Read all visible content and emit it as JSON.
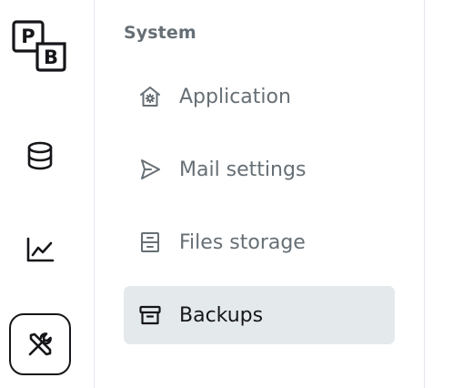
{
  "logo": {
    "letter_top": "P",
    "letter_bottom": "B"
  },
  "rail": {
    "items": [
      {
        "icon": "database-icon",
        "active": false
      },
      {
        "icon": "chart-line-icon",
        "active": false
      },
      {
        "icon": "tools-icon",
        "active": true
      }
    ]
  },
  "sidebar": {
    "section_title": "System",
    "items": [
      {
        "label": "Application",
        "icon": "home-gear-icon",
        "active": false
      },
      {
        "label": "Mail settings",
        "icon": "send-icon",
        "active": false
      },
      {
        "label": "Files storage",
        "icon": "archive-drawer-icon",
        "active": false
      },
      {
        "label": "Backups",
        "icon": "archive-box-icon",
        "active": true
      }
    ]
  },
  "colors": {
    "text_muted": "#666f75",
    "text_active": "#16161a",
    "active_bg": "#e4e9ec",
    "border": "#e3e8ef"
  }
}
